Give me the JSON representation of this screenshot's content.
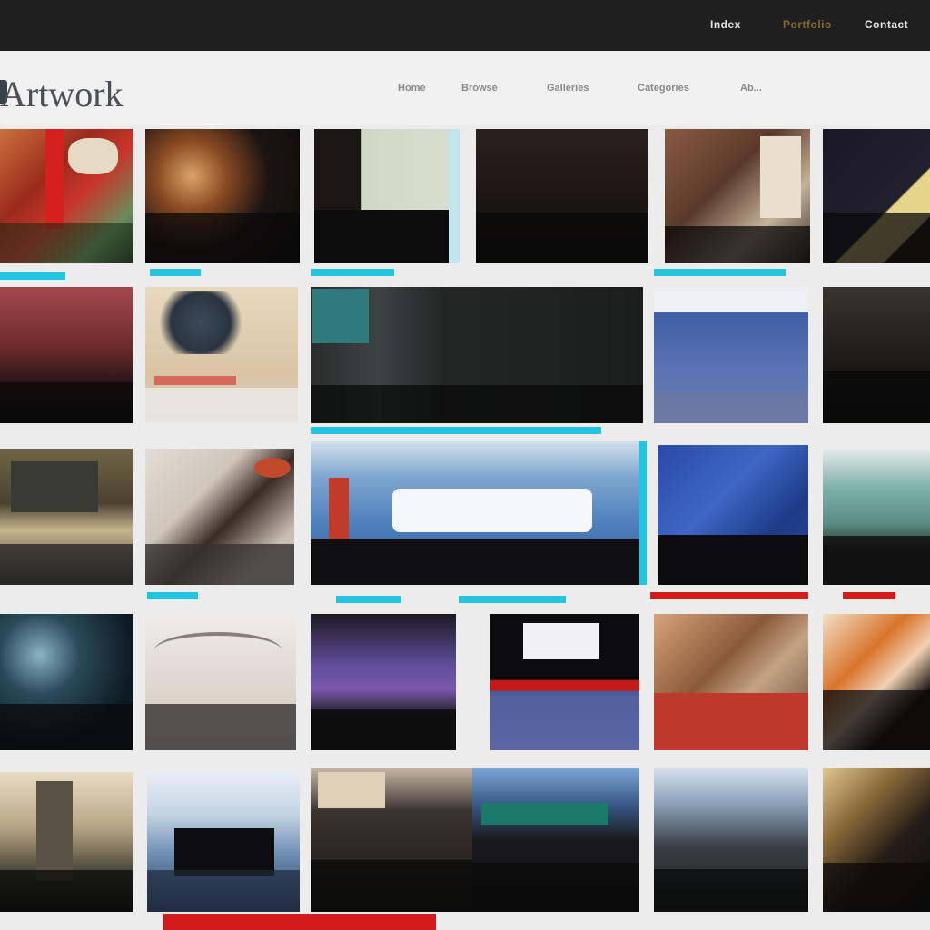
{
  "app": {
    "logo_text": "Artwork"
  },
  "top_nav": {
    "items": [
      "Index",
      "Portfolio",
      "Contact"
    ],
    "active_index": 1
  },
  "main_nav": {
    "items": [
      "Home",
      "Browse",
      "Galleries",
      "Categories",
      "Ab..."
    ]
  },
  "colors": {
    "topbar": "#1f1f1f",
    "header": "#f1f1f1",
    "background": "#ececec",
    "accent_cyan": "#22c4e0",
    "accent_red": "#d41b1b",
    "logo": "#4a4f5a"
  },
  "gallery": {
    "tiles": [
      {
        "caption": ""
      },
      {
        "caption": ""
      },
      {
        "caption": ""
      },
      {
        "caption": ""
      },
      {
        "caption": ""
      },
      {
        "caption": ""
      },
      {
        "caption": ""
      },
      {
        "caption": ""
      },
      {
        "caption": ""
      },
      {
        "caption": ""
      },
      {
        "caption": ""
      },
      {
        "caption": ""
      },
      {
        "caption": ""
      },
      {
        "caption": ""
      },
      {
        "caption": ""
      },
      {
        "caption": ""
      },
      {
        "caption": ""
      },
      {
        "caption": ""
      },
      {
        "caption": ""
      },
      {
        "caption": ""
      },
      {
        "caption": ""
      },
      {
        "caption": ""
      },
      {
        "caption": ""
      },
      {
        "caption": ""
      },
      {
        "caption": ""
      },
      {
        "caption": ""
      },
      {
        "caption": ""
      },
      {
        "caption": ""
      }
    ]
  }
}
